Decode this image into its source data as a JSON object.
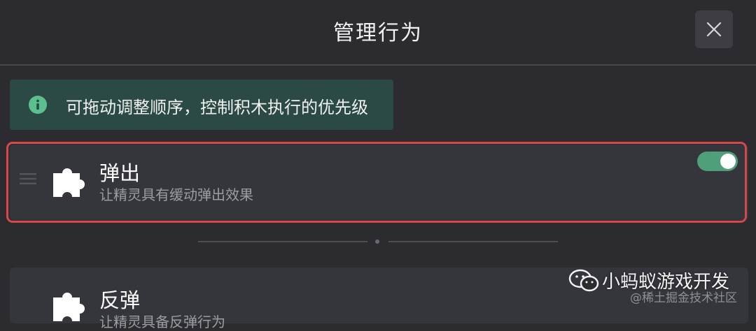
{
  "header": {
    "title": "管理行为",
    "close_icon": "close-icon"
  },
  "tip": {
    "icon": "info-icon",
    "text": "可拖动调整顺序，控制积木执行的优先级",
    "background": "#2b4a45"
  },
  "behaviors": [
    {
      "name": "弹出",
      "description": "让精灵具有缓动弹出效果",
      "icon": "puzzle-piece-icon",
      "enabled": true,
      "highlighted": true
    },
    {
      "name": "反弹",
      "description": "让精灵具备反弹行为",
      "icon": "puzzle-piece-icon"
    }
  ],
  "watermark": {
    "icon": "wechat-icon",
    "text": "小蚂蚁游戏开发"
  },
  "credit": "@稀土掘金技术社区",
  "colors": {
    "background": "#2b2b30",
    "card": "#35353c",
    "toggle_on": "#4fa07a",
    "highlight_border": "#d94848"
  }
}
